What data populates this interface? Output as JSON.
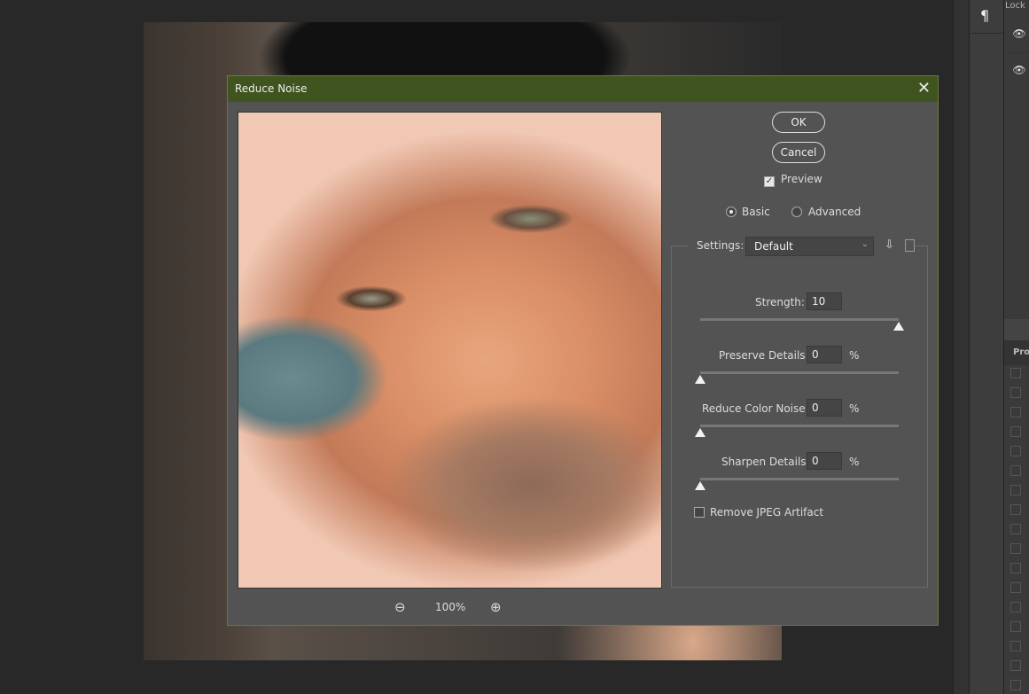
{
  "dialog": {
    "title": "Reduce Noise",
    "ok": "OK",
    "cancel": "Cancel",
    "preview_label": "Preview",
    "preview_checked": true,
    "mode_basic": "Basic",
    "mode_advanced": "Advanced",
    "mode_selected": "Basic",
    "settings_label": "Settings:",
    "settings_value": "Default",
    "strength_label": "Strength:",
    "strength_value": "10",
    "strength_max": 10,
    "preserve_label": "Preserve Details:",
    "preserve_value": "0",
    "color_noise_label": "Reduce Color Noise:",
    "color_noise_value": "0",
    "sharpen_label": "Sharpen Details:",
    "sharpen_value": "0",
    "percent": "%",
    "jpeg_label": "Remove JPEG Artifact",
    "jpeg_checked": false,
    "zoom": "100%"
  },
  "panels": {
    "lock_label": "Lock",
    "properties_label": "Pro",
    "paragraph_icon": "¶"
  },
  "colors": {
    "titlebar": "#3f541e",
    "dialog_bg": "#535353"
  }
}
